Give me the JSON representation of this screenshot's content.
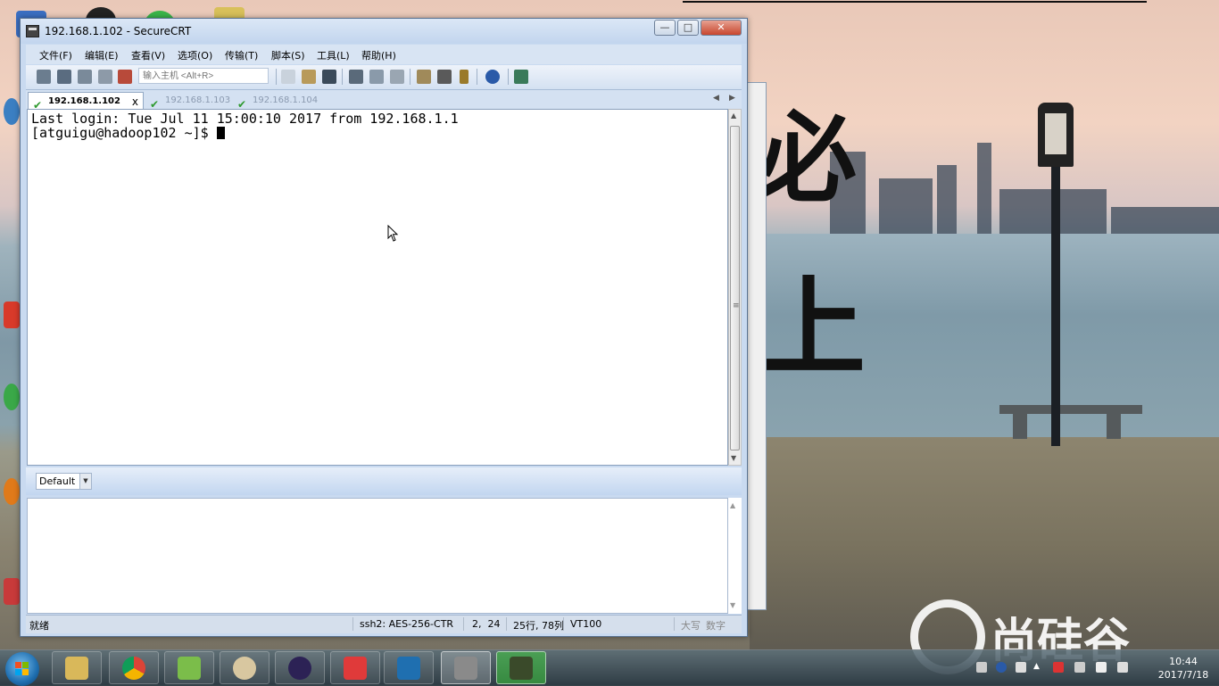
{
  "window": {
    "title": "192.168.1.102 - SecureCRT",
    "controls": {
      "minimize": "—",
      "maximize": "□",
      "close": "✕"
    }
  },
  "menu": [
    "文件(F)",
    "编辑(E)",
    "查看(V)",
    "选项(O)",
    "传输(T)",
    "脚本(S)",
    "工具(L)",
    "帮助(H)"
  ],
  "toolbar": {
    "host_placeholder": "输入主机 <Alt+R>",
    "icons": [
      "connect-icon",
      "quick-connect-icon",
      "connect-tab-icon",
      "reconnect-icon",
      "disconnect-icon",
      "copy-icon",
      "paste-icon",
      "find-icon",
      "print-icon",
      "print-selection-icon",
      "print-setup-icon",
      "session-options-icon",
      "global-options-icon",
      "keymap-icon",
      "help-icon",
      "sftp-icon"
    ]
  },
  "tabs": [
    {
      "label": "192.168.1.102",
      "active": true,
      "close": "x"
    },
    {
      "label": "192.168.1.103",
      "active": false
    },
    {
      "label": "192.168.1.104",
      "active": false
    }
  ],
  "terminal": {
    "lines": [
      "Last login: Tue Jul 11 15:00:10 2017 from 192.168.1.1",
      "[atguigu@hadoop102 ~]$ "
    ]
  },
  "command_bar": {
    "session": "Default"
  },
  "statusbar": {
    "ready": "就绪",
    "cipher": "ssh2: AES-256-CTR",
    "cursor_pos": "2,  24",
    "size": "25行, 78列",
    "terminal_type": "VT100",
    "caps": "大写",
    "num": "数字"
  },
  "desktop": {
    "calligraphy": [
      "必",
      "上"
    ],
    "logo_text": "尚硅谷"
  },
  "taskbar": {
    "apps": [
      "explorer-icon",
      "chrome-icon",
      "notepad-plus-plus-icon",
      "paint-icon",
      "eclipse-icon",
      "xmind-icon",
      "virtualbox-icon",
      "securecrt-icon",
      "camtasia-icon"
    ],
    "clock_time": "10:44",
    "clock_date": "2017/7/18"
  },
  "colors": {
    "title_bar": "#c2d5ee",
    "tab_check": "#2f9a2f",
    "close_button": "#c8462e"
  }
}
